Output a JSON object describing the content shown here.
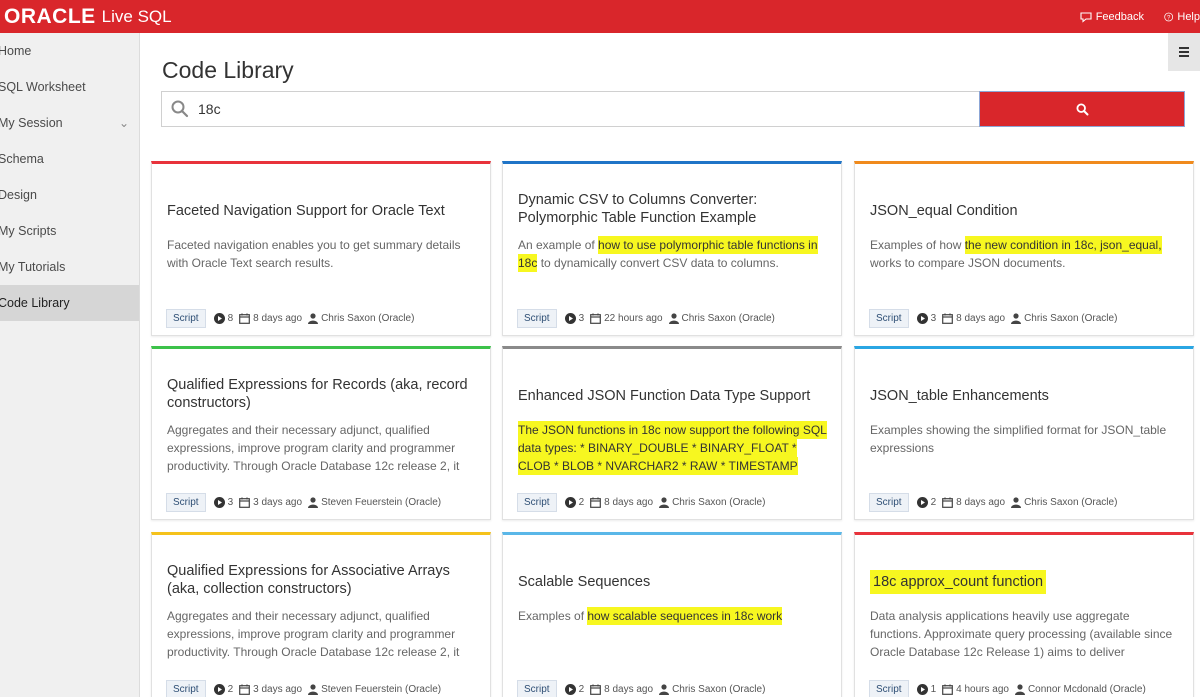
{
  "app": {
    "logo": "ORACLE",
    "product": "Live SQL"
  },
  "top_links": {
    "feedback": "Feedback",
    "help": "Help"
  },
  "sidebar": {
    "items": [
      {
        "label": "Home"
      },
      {
        "label": "SQL Worksheet"
      },
      {
        "label": "My Session"
      },
      {
        "label": "Schema"
      },
      {
        "label": "Design"
      },
      {
        "label": "My Scripts"
      },
      {
        "label": "My Tutorials"
      },
      {
        "label": "Code Library"
      }
    ],
    "active": "Code Library"
  },
  "page": {
    "title": "Code Library"
  },
  "search": {
    "value": "18c",
    "placeholder": ""
  },
  "colors": {
    "brand": "#d9262b",
    "highlight": "#f7f720"
  },
  "cards": [
    {
      "title": "Faceted Navigation Support for Oracle Text",
      "desc": "Faceted navigation enables you to get summary details with Oracle Text search results.",
      "desc_pre": "Faceted navigation enables you to get summary details with Oracle Text search results.",
      "desc_hl": "",
      "desc_post": "",
      "accent": "#e8333b",
      "type": "Script",
      "runs": "8",
      "updated": "8 days ago",
      "author": "Chris Saxon (Oracle)"
    },
    {
      "title": "Dynamic CSV to Columns Converter: Polymorphic Table Function Example",
      "desc_pre": "An example of ",
      "desc_hl": "how to use polymorphic table functions in 18c",
      "desc_post": " to dynamically convert CSV data to columns.",
      "accent": "#1f74c7",
      "type": "Script",
      "runs": "3",
      "updated": "22 hours ago",
      "author": "Chris Saxon (Oracle)"
    },
    {
      "title": "JSON_equal Condition",
      "desc_pre": "Examples of how ",
      "desc_hl": "the new condition in 18c, json_equal,",
      "desc_post": " works to compare JSON documents.",
      "accent": "#f08a1c",
      "type": "Script",
      "runs": "3",
      "updated": "8 days ago",
      "author": "Chris Saxon (Oracle)"
    },
    {
      "title": "Qualified Expressions for Records (aka, record constructors)",
      "desc_pre": "Aggregates and their necessary adjunct, qualified expressions, improve program clarity and programmer productivity. Through Oracle Database 12c release 2, it",
      "desc_hl": "",
      "desc_post": "",
      "accent": "#3cc24a",
      "type": "Script",
      "runs": "3",
      "updated": "3 days ago",
      "author": "Steven Feuerstein (Oracle)"
    },
    {
      "title": "Enhanced JSON Function Data Type Support",
      "desc_pre": "",
      "desc_hl": "The JSON functions in 18c now support the following SQL data types: * BINARY_DOUBLE * BINARY_FLOAT * CLOB * BLOB * NVARCHAR2 * RAW * TIMESTAMP",
      "desc_post": "",
      "accent": "#8a8a8a",
      "type": "Script",
      "runs": "2",
      "updated": "8 days ago",
      "author": "Chris Saxon (Oracle)"
    },
    {
      "title": "JSON_table Enhancements",
      "desc_pre": "Examples showing the simplified format for JSON_table expressions",
      "desc_hl": "",
      "desc_post": "",
      "accent": "#2aa6e3",
      "type": "Script",
      "runs": "2",
      "updated": "8 days ago",
      "author": "Chris Saxon (Oracle)"
    },
    {
      "title": "Qualified Expressions for Associative Arrays (aka, collection constructors)",
      "desc_pre": "Aggregates and their necessary adjunct, qualified expressions, improve program clarity and programmer productivity. Through Oracle Database 12c release 2, it",
      "desc_hl": "",
      "desc_post": "",
      "accent": "#f5c21b",
      "type": "Script",
      "runs": "2",
      "updated": "3 days ago",
      "author": "Steven Feuerstein (Oracle)"
    },
    {
      "title": "Scalable Sequences",
      "desc_pre": "Examples of ",
      "desc_hl": "how scalable sequences in 18c work",
      "desc_post": "",
      "accent": "#5ab7e8",
      "type": "Script",
      "runs": "2",
      "updated": "8 days ago",
      "author": "Chris Saxon (Oracle)"
    },
    {
      "title": "18c approx_count function",
      "title_hl": true,
      "desc_pre": "Data analysis applications heavily use aggregate functions. Approximate query processing (available since Oracle Database 12c Release 1) aims to deliver",
      "desc_hl": "",
      "desc_post": "",
      "accent": "#e8333b",
      "type": "Script",
      "runs": "1",
      "updated": "4 hours ago",
      "author": "Connor Mcdonald (Oracle)"
    }
  ]
}
